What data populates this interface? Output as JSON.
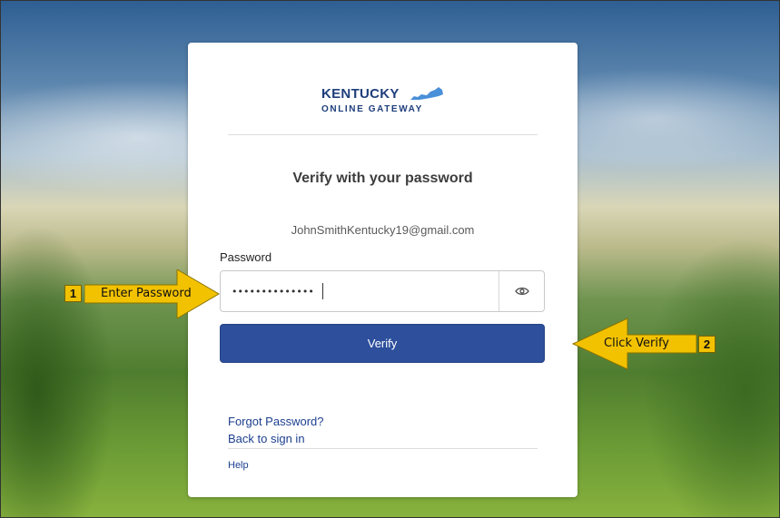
{
  "logo": {
    "line1": "KENTUCKY",
    "line2": "ONLINE GATEWAY"
  },
  "heading": "Verify with your password",
  "identifier": "JohnSmithKentucky19@gmail.com",
  "password": {
    "label": "Password",
    "value": "••••••••••••••"
  },
  "verify_button": "Verify",
  "links": {
    "forgot": "Forgot Password?",
    "back": "Back to sign in",
    "help": "Help"
  },
  "annotations": [
    {
      "number": "1",
      "text": "Enter Password"
    },
    {
      "number": "2",
      "text": "Click Verify"
    }
  ],
  "colors": {
    "brand": "#1e3e7c",
    "button": "#2d4f9c",
    "callout": "#f2c200"
  }
}
